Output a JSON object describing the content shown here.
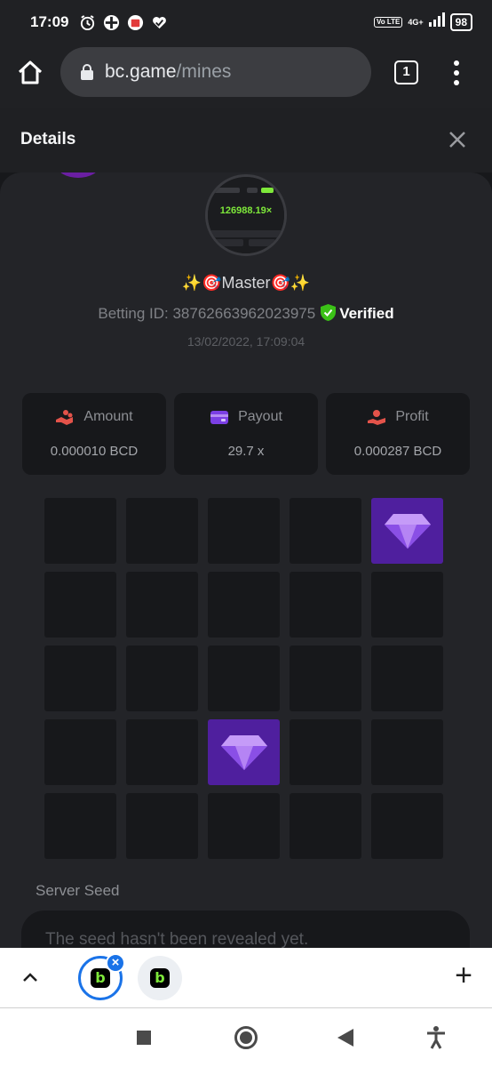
{
  "status_bar": {
    "time": "17:09",
    "network": "4G+",
    "volte": "Vo LTE",
    "battery": "98"
  },
  "browser": {
    "url_host": "bc.game",
    "url_path": "/mines",
    "tab_count": "1"
  },
  "details": {
    "title": "Details",
    "close_icon": "close-icon"
  },
  "player": {
    "avatar_value": "126988.19×",
    "username": "✨🎯Master🎯✨",
    "betting_id_label": "Betting ID: 38762663962023975",
    "verified_label": "Verified",
    "date": "13/02/2022, 17:09:04"
  },
  "stats": [
    {
      "label": "Amount",
      "value": "0.000010 BCD",
      "icon": "coins-hand-icon",
      "color": "#e4534a"
    },
    {
      "label": "Payout",
      "value": "29.7 x",
      "icon": "wallet-icon",
      "color": "#7b3fe4"
    },
    {
      "label": "Profit",
      "value": "0.000287 BCD",
      "icon": "profit-hand-icon",
      "color": "#e4534a"
    }
  ],
  "board": {
    "gem_positions": [
      4,
      17
    ],
    "gem_color": "#a46bf0",
    "tile_color": "#17181b",
    "gem_bg": "#4f1f9e"
  },
  "seed": {
    "label": "Server Seed",
    "value": "The seed hasn't been revealed yet."
  },
  "tabstrip": {
    "close_label": "×",
    "new_tab_label": "+",
    "logo_letter": "b"
  }
}
